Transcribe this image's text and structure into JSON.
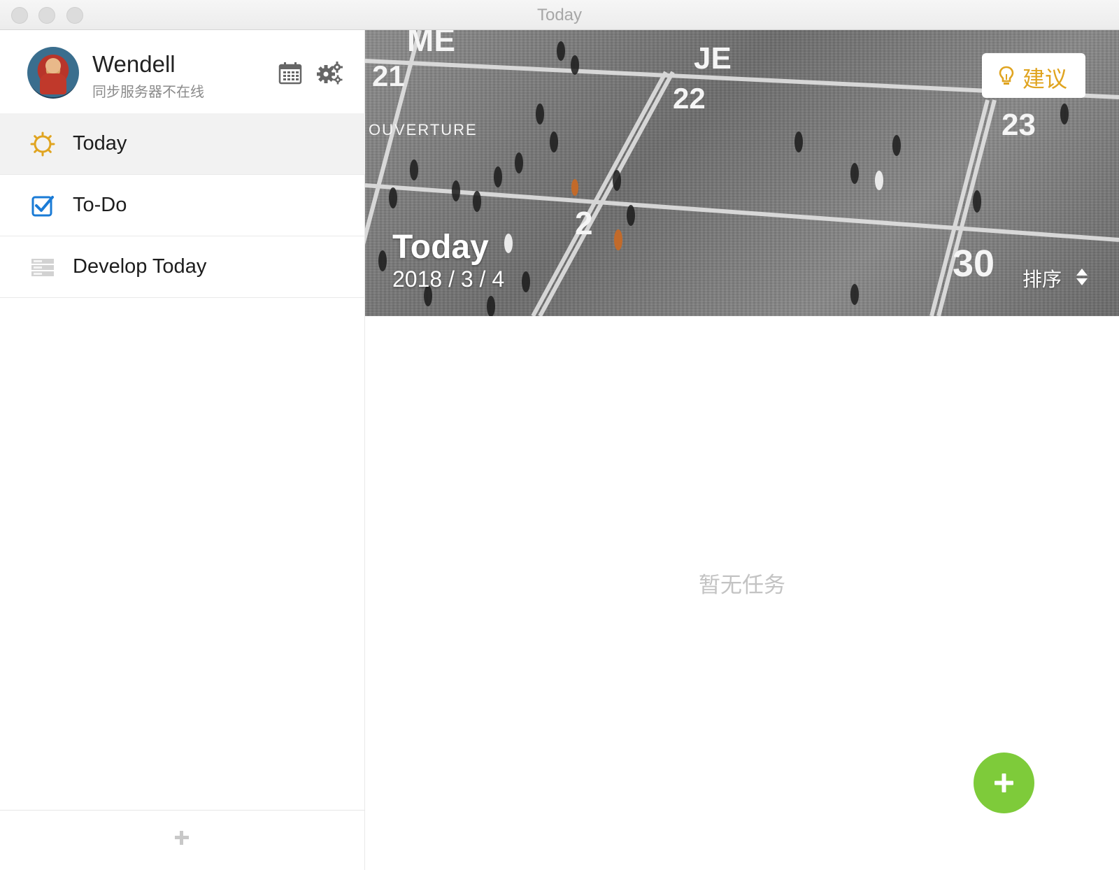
{
  "window": {
    "title": "Today"
  },
  "profile": {
    "name": "Wendell",
    "status": "同步服务器不在线"
  },
  "nav": {
    "items": [
      {
        "label": "Today",
        "icon": "sun-icon",
        "active": true
      },
      {
        "label": "To-Do",
        "icon": "checkbox-icon",
        "active": false
      },
      {
        "label": "Develop Today",
        "icon": "list-icon",
        "active": false
      }
    ]
  },
  "banner": {
    "title": "Today",
    "date": "2018 / 3 / 4",
    "suggest_label": "建议",
    "sort_label": "排序"
  },
  "main": {
    "empty_text": "暂无任务"
  },
  "colors": {
    "accent_yellow": "#e0a420",
    "checkbox_blue": "#1a7bd6",
    "fab_green": "#7ecb3a"
  }
}
